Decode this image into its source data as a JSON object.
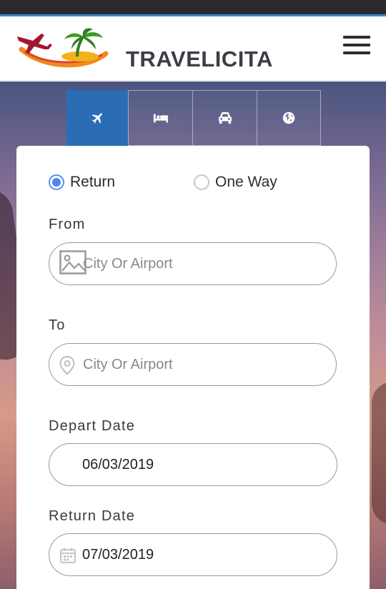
{
  "header": {
    "brand": "TRAVELICITA",
    "menu_icon": "hamburger-menu-icon"
  },
  "tabs": [
    {
      "icon": "plane-icon",
      "active": true
    },
    {
      "icon": "bed-icon",
      "active": false
    },
    {
      "icon": "car-icon",
      "active": false
    },
    {
      "icon": "globe-icon",
      "active": false
    }
  ],
  "trip_type": {
    "options": [
      {
        "label": "Return",
        "checked": true
      },
      {
        "label": "One Way",
        "checked": false
      }
    ]
  },
  "form": {
    "from": {
      "label": "From",
      "placeholder": "City Or Airport",
      "icon": "broken-image-icon"
    },
    "to": {
      "label": "To",
      "placeholder": "City Or Airport",
      "icon": "location-pin-icon"
    },
    "depart": {
      "label": "Depart Date",
      "value": "06/03/2019"
    },
    "return": {
      "label": "Return Date",
      "value": "07/03/2019",
      "icon": "calendar-icon"
    }
  },
  "colors": {
    "accent": "#2a6db5",
    "radio": "#4f86f0",
    "statusbar": "#2b2b2b"
  }
}
